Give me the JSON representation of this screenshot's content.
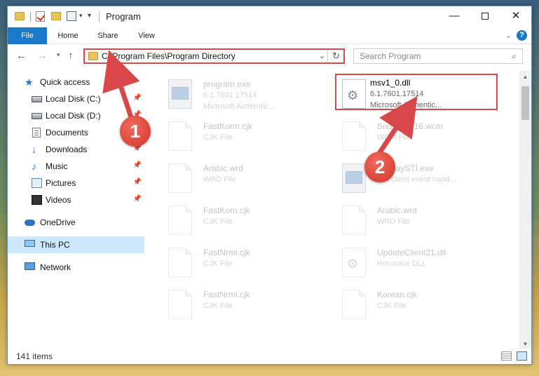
{
  "window": {
    "title": "Program",
    "controls": {
      "minimize": "—",
      "maximize": "",
      "close": "✕"
    }
  },
  "ribbon": {
    "tabs": [
      "File",
      "Home",
      "Share",
      "View"
    ],
    "help": "?"
  },
  "nav": {
    "address": "C:\\Program Files\\Program Directory",
    "search_placeholder": "Search Program"
  },
  "sidebar": {
    "items": [
      {
        "label": "Quick access",
        "icon": "star-icon"
      },
      {
        "label": "Local Disk (C:)",
        "icon": "disk-icon"
      },
      {
        "label": "Local Disk (D:)",
        "icon": "disk-icon"
      },
      {
        "label": "Documents",
        "icon": "documents-icon"
      },
      {
        "label": "Downloads",
        "icon": "downloads-icon"
      },
      {
        "label": "Music",
        "icon": "music-icon"
      },
      {
        "label": "Pictures",
        "icon": "pictures-icon"
      },
      {
        "label": "Videos",
        "icon": "videos-icon"
      },
      {
        "label": "OneDrive",
        "icon": "onedrive-icon"
      },
      {
        "label": "This PC",
        "icon": "pc-icon"
      },
      {
        "label": "Network",
        "icon": "network-icon"
      }
    ]
  },
  "files": [
    {
      "name": "program.exe",
      "line1": "6.1.7601.17514",
      "line2": "Microsoft Authentic...",
      "icon": "exe-icon"
    },
    {
      "name": "msv1_0.dll",
      "line1": "6.1.7601.17514",
      "line2": "Microsoft Authentic...",
      "icon": "gear-file-icon"
    },
    {
      "name": "FastKorm.cjk",
      "line1": "CJK File",
      "line2": "",
      "icon": "file-icon"
    },
    {
      "name": "SndVol2P16.wcm",
      "line1": "WCM File",
      "line2": "",
      "icon": "file-icon"
    },
    {
      "name": "Arabic.wrd",
      "line1": "WRD File",
      "line2": "",
      "icon": "file-icon"
    },
    {
      "name": "DisplaySTI.exe",
      "line1": "STI client event hand...",
      "line2": "",
      "icon": "exe-icon"
    },
    {
      "name": "FastKorn.cjk",
      "line1": "CJK File",
      "line2": "",
      "icon": "file-icon"
    },
    {
      "name": "Arabic.wrd",
      "line1": "WRD File",
      "line2": "",
      "icon": "file-icon"
    },
    {
      "name": "FastNrml.cjk",
      "line1": "CJK File",
      "line2": "",
      "icon": "file-icon"
    },
    {
      "name": "UpdateClient21.dll",
      "line1": "Resource DLL",
      "line2": "",
      "icon": "gear-file-icon"
    },
    {
      "name": "FastNrml.cjk",
      "line1": "CJK File",
      "line2": "",
      "icon": "file-icon"
    },
    {
      "name": "Korean.cjk",
      "line1": "CJK File",
      "line2": "",
      "icon": "file-icon"
    }
  ],
  "status": {
    "count": "141 items"
  },
  "annotations": {
    "badge1": "1",
    "badge2": "2"
  },
  "colors": {
    "accent": "#1979ca",
    "annotation": "#d9474a",
    "selected": "#cce8ff"
  }
}
